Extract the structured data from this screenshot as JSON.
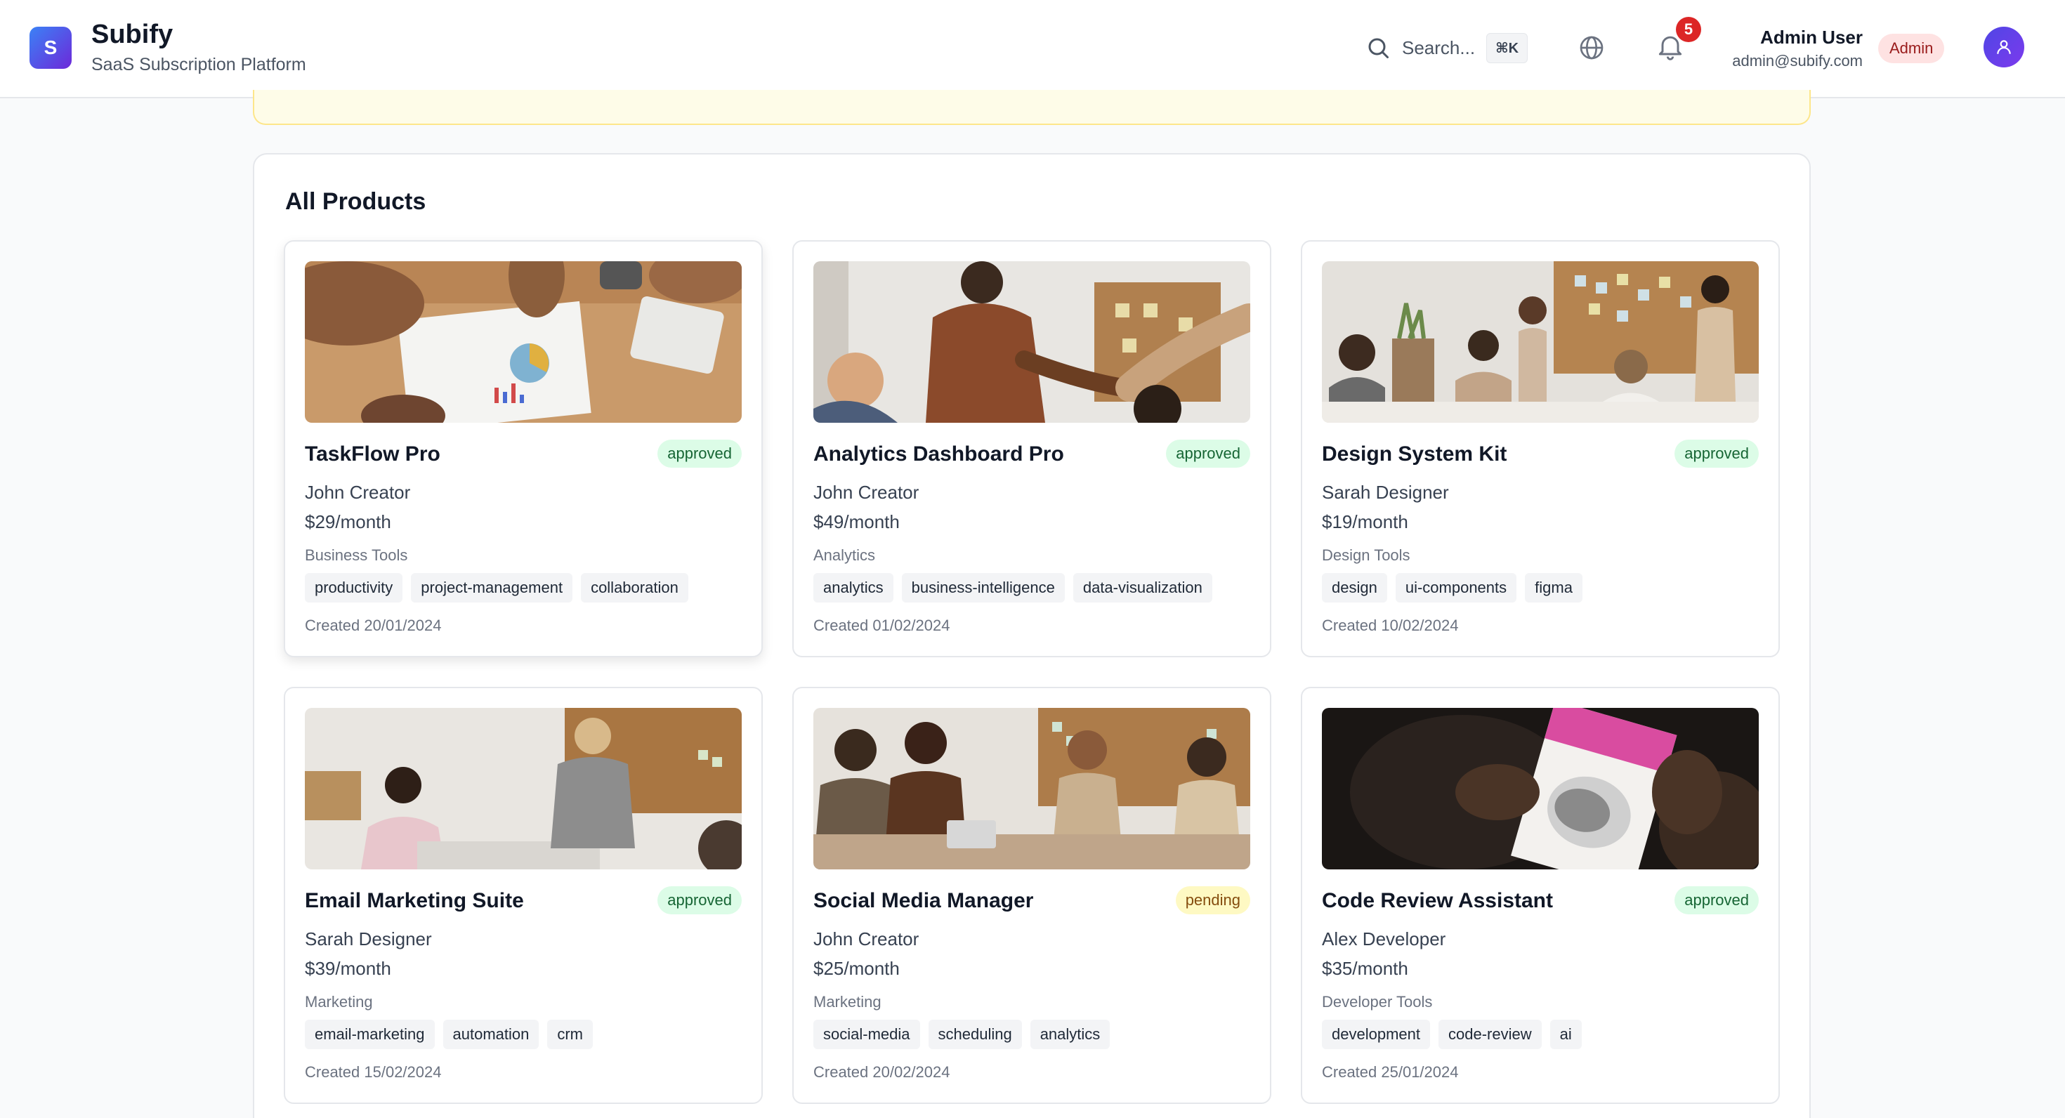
{
  "app": {
    "logo_letter": "S",
    "name": "Subify",
    "tagline": "SaaS Subscription Platform"
  },
  "header": {
    "search_label": "Search...",
    "search_shortcut": "⌘K",
    "notifications_count": "5",
    "user_name": "Admin User",
    "user_email": "admin@subify.com",
    "user_role": "Admin"
  },
  "products": {
    "title": "All Products",
    "items": [
      {
        "name": "TaskFlow Pro",
        "status": "approved",
        "creator": "John Creator",
        "price": "$29/month",
        "category": "Business Tools",
        "tags": [
          "productivity",
          "project-management",
          "collaboration"
        ],
        "created": "Created 20/01/2024"
      },
      {
        "name": "Analytics Dashboard Pro",
        "status": "approved",
        "creator": "John Creator",
        "price": "$49/month",
        "category": "Analytics",
        "tags": [
          "analytics",
          "business-intelligence",
          "data-visualization"
        ],
        "created": "Created 01/02/2024"
      },
      {
        "name": "Design System Kit",
        "status": "approved",
        "creator": "Sarah Designer",
        "price": "$19/month",
        "category": "Design Tools",
        "tags": [
          "design",
          "ui-components",
          "figma"
        ],
        "created": "Created 10/02/2024"
      },
      {
        "name": "Email Marketing Suite",
        "status": "approved",
        "creator": "Sarah Designer",
        "price": "$39/month",
        "category": "Marketing",
        "tags": [
          "email-marketing",
          "automation",
          "crm"
        ],
        "created": "Created 15/02/2024"
      },
      {
        "name": "Social Media Manager",
        "status": "pending",
        "creator": "John Creator",
        "price": "$25/month",
        "category": "Marketing",
        "tags": [
          "social-media",
          "scheduling",
          "analytics"
        ],
        "created": "Created 20/02/2024"
      },
      {
        "name": "Code Review Assistant",
        "status": "approved",
        "creator": "Alex Developer",
        "price": "$35/month",
        "category": "Developer Tools",
        "tags": [
          "development",
          "code-review",
          "ai"
        ],
        "created": "Created 25/01/2024"
      }
    ]
  },
  "colors": {
    "accent": "#4f46e5",
    "approved_bg": "#dcfce7",
    "approved_text": "#166534",
    "pending_bg": "#fef9c3",
    "pending_text": "#854d0e",
    "notification": "#dc2626"
  }
}
